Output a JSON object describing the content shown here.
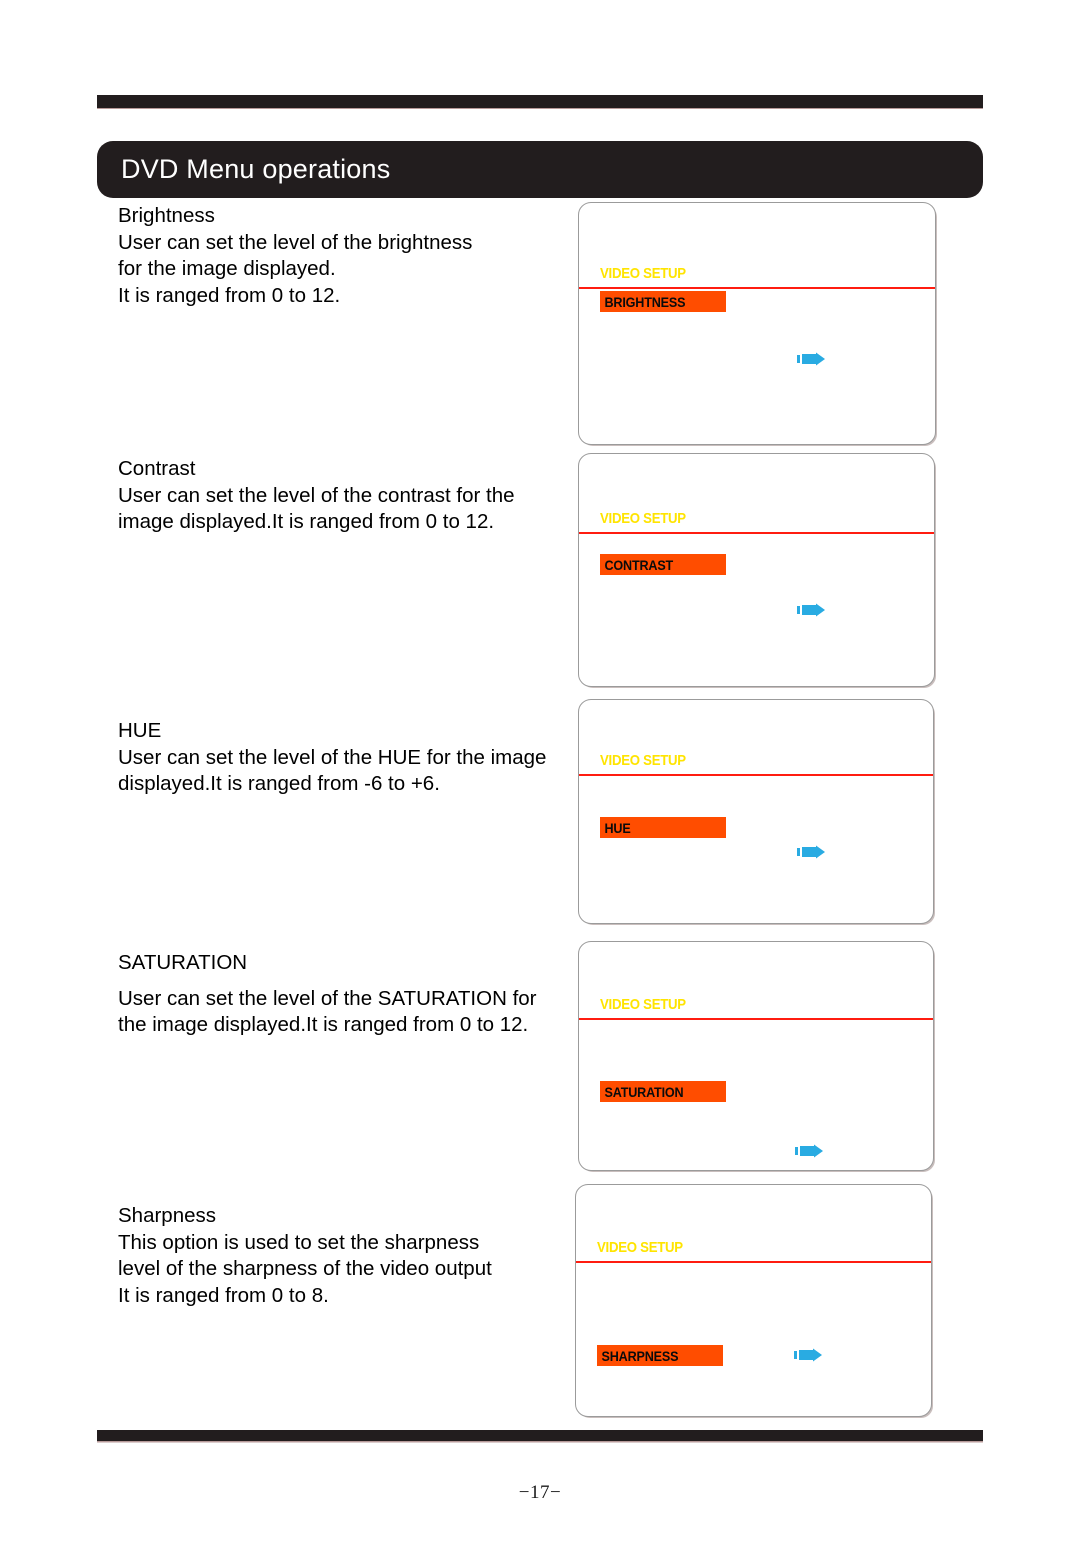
{
  "header": {
    "title": "DVD Menu operations"
  },
  "footer": {
    "page_number": "−17−"
  },
  "colors": {
    "banner_bg": "#221d1e",
    "osd_title": "#ffe400",
    "osd_divider": "#ff1c10",
    "osd_highlight": "#ff4d00",
    "osd_cursor": "#29abe2",
    "page_bg": "#ffffff"
  },
  "sections": [
    {
      "heading": "Brightness",
      "body_line1": "User can set the level of the brightness",
      "body_line2": "for the image displayed.",
      "body_line3": "It is ranged from 0 to 12.",
      "panel": {
        "title": "VIDEO SETUP",
        "item": "BRIGHTNESS",
        "cursor": "right-arrow-cursor"
      }
    },
    {
      "heading": "Contrast",
      "body_line1": "User can set the level of the contrast for the",
      "body_line2": "image displayed.It is ranged from 0 to 12.",
      "body_line3": "",
      "panel": {
        "title": "VIDEO SETUP",
        "item": "CONTRAST",
        "cursor": "right-arrow-cursor"
      }
    },
    {
      "heading": "HUE",
      "body_line1": "User can set the level of the HUE for the image",
      "body_line2": "displayed.It is ranged from -6 to +6.",
      "body_line3": "",
      "panel": {
        "title": "VIDEO SETUP",
        "item": "HUE",
        "cursor": "right-arrow-cursor"
      }
    },
    {
      "heading": "SATURATION",
      "body_line1": "User can set the level of the SATURATION for",
      "body_line2": "the image displayed.It is ranged from 0 to 12.",
      "body_line3": "",
      "panel": {
        "title": "VIDEO SETUP",
        "item": "SATURATION",
        "cursor": "right-arrow-cursor"
      }
    },
    {
      "heading": "Sharpness",
      "body_line1": "This option is used to set the sharpness",
      "body_line2": "level of the sharpness of the video output",
      "body_line3": "It is ranged from 0 to 8.",
      "panel": {
        "title": "VIDEO SETUP",
        "item": "SHARPNESS",
        "cursor": "right-arrow-cursor"
      }
    }
  ]
}
